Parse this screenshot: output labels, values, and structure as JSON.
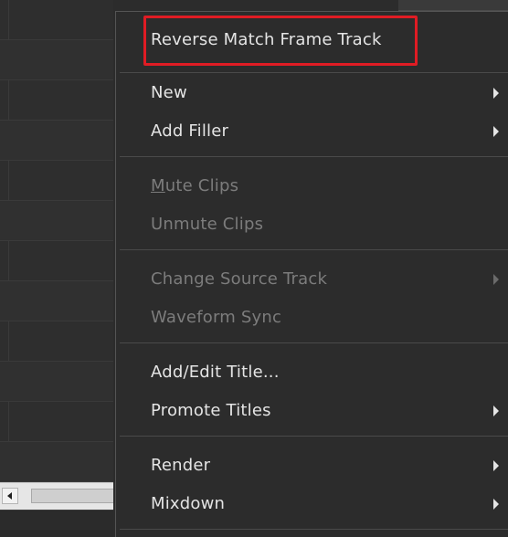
{
  "menu": {
    "items": [
      {
        "label": "Reverse Match Frame Track",
        "enabled": true,
        "submenu": false,
        "highlighted": true
      },
      {
        "label": "New",
        "enabled": true,
        "submenu": true
      },
      {
        "label": "Add Filler",
        "enabled": true,
        "submenu": true
      },
      {
        "label_mnemonic": "M",
        "label_rest": "ute Clips",
        "enabled": false,
        "submenu": false
      },
      {
        "label": "Unmute Clips",
        "enabled": false,
        "submenu": false
      },
      {
        "label": "Change Source Track",
        "enabled": false,
        "submenu": true
      },
      {
        "label": "Waveform Sync",
        "enabled": false,
        "submenu": false
      },
      {
        "label": "Add/Edit Title...",
        "enabled": true,
        "submenu": false
      },
      {
        "label": "Promote Titles",
        "enabled": true,
        "submenu": true
      },
      {
        "label": "Render",
        "enabled": true,
        "submenu": true
      },
      {
        "label": "Mixdown",
        "enabled": true,
        "submenu": true
      }
    ]
  },
  "colors": {
    "menu_background": "#2c2c2c",
    "text_enabled": "#e4e4e4",
    "text_disabled": "#7c7c7c",
    "highlight_border": "#e01c24"
  },
  "icons": {
    "submenu": "chevron-right-icon",
    "scroll_left": "arrow-left-icon"
  }
}
